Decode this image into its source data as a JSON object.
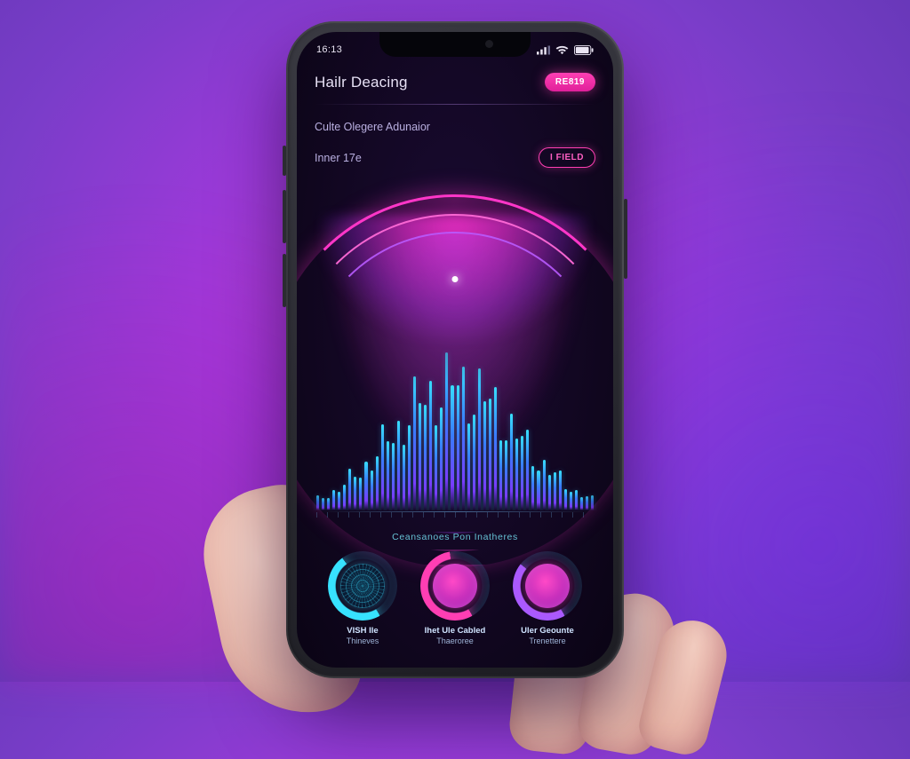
{
  "status": {
    "left": "16:13"
  },
  "header": {
    "title": "Hailr Deacing",
    "badge": "RE819"
  },
  "rows": {
    "r1_label": "Culte Olegere Adunaior",
    "r2_label": "Inner 17e",
    "r2_badge": "I FIELD"
  },
  "section_label": "Ceansanoes Pon Inatheres",
  "dials": [
    {
      "line1": "VISH Ile",
      "line2": "Thineves",
      "progress": 0.58,
      "color": "cyan",
      "style": "mesh"
    },
    {
      "line1": "Ihet Ule Cabled",
      "line2": "Thaeroree",
      "progress": 0.67,
      "color": "magenta",
      "style": "core"
    },
    {
      "line1": "Uler Geounte",
      "line2": "Trenettere",
      "progress": 0.53,
      "color": "violet",
      "style": "core"
    }
  ],
  "viz_bar_count": 52
}
